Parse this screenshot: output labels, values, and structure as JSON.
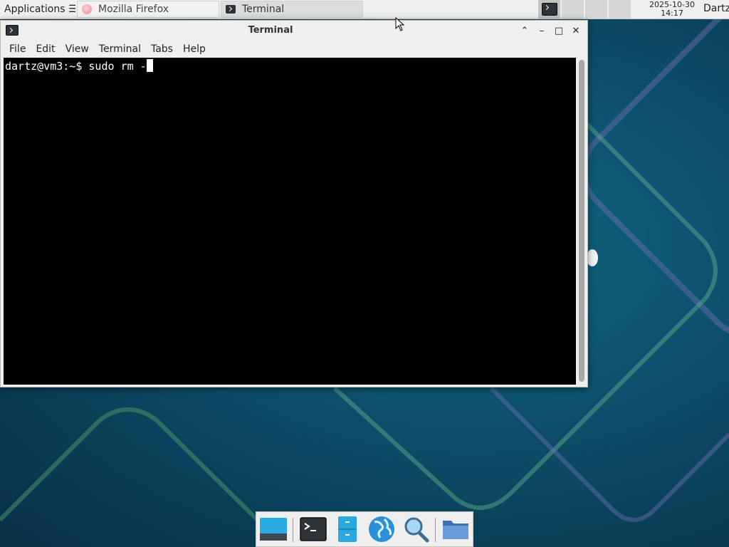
{
  "panel": {
    "applications_label": "Applications ☰",
    "tasks": [
      {
        "label": "Mozilla Firefox",
        "icon": "firefox-icon"
      },
      {
        "label": "Terminal",
        "icon": "terminal-icon"
      }
    ],
    "clock_date": "2025-10-30",
    "clock_time": "14:17",
    "user": "Dartz"
  },
  "window": {
    "title": "Terminal",
    "menu": [
      "File",
      "Edit",
      "View",
      "Terminal",
      "Tabs",
      "Help"
    ],
    "controls": {
      "shade": "⌃",
      "minimize": "–",
      "maximize": "□",
      "close": "✕"
    }
  },
  "terminal": {
    "prompt": "dartz@vm3:~$ ",
    "input": "sudo rm -"
  },
  "dock": {
    "items": [
      "show-desktop-icon",
      "terminal-icon",
      "file-manager-icon",
      "web-browser-icon",
      "app-finder-icon",
      "folder-icon"
    ]
  },
  "colors": {
    "desktop": "#0d5470",
    "panel": "#efefef",
    "terminal_bg": "#000000"
  }
}
